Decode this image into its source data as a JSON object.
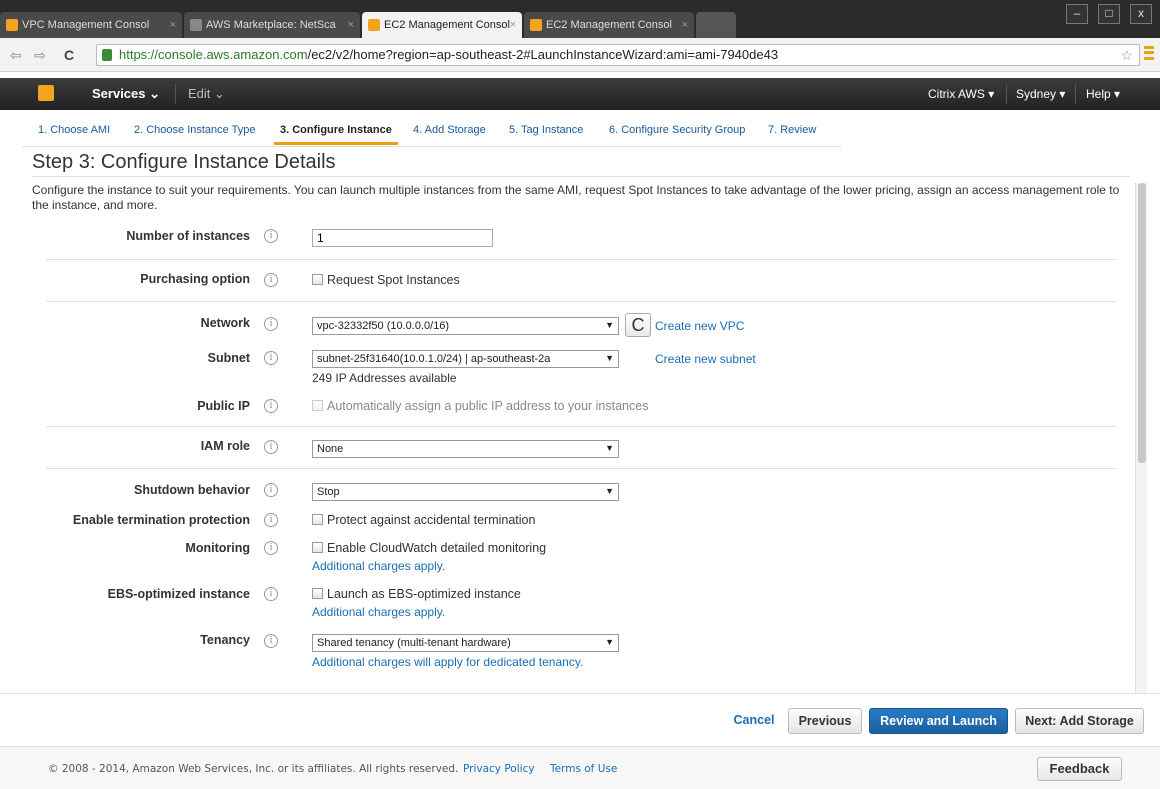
{
  "browser": {
    "tabs": [
      {
        "label": "VPC Management Consol",
        "active": false
      },
      {
        "label": "AWS Marketplace: NetSca",
        "active": false
      },
      {
        "label": "EC2 Management Consol",
        "active": true
      },
      {
        "label": "EC2 Management Consol",
        "active": false
      }
    ],
    "url_host": "https://console.aws.amazon.com",
    "url_path": "/ec2/v2/home?region=ap-southeast-2#LaunchInstanceWizard:ami=ami-7940de43"
  },
  "awsbar": {
    "services": "Services",
    "edit": "Edit",
    "account": "Citrix AWS",
    "region": "Sydney",
    "help": "Help"
  },
  "wizard": {
    "steps": [
      "1. Choose AMI",
      "2. Choose Instance Type",
      "3. Configure Instance",
      "4. Add Storage",
      "5. Tag Instance",
      "6. Configure Security Group",
      "7. Review"
    ],
    "active_step": 2,
    "title": "Step 3: Configure Instance Details",
    "description": "Configure the instance to suit your requirements. You can launch multiple instances from the same AMI, request Spot Instances to take advantage of the lower pricing, assign an access management role to the instance, and more."
  },
  "form": {
    "num_instances_label": "Number of instances",
    "num_instances_value": "1",
    "purchasing_label": "Purchasing option",
    "purchasing_cb": "Request Spot Instances",
    "network_label": "Network",
    "network_value": "vpc-32332f50 (10.0.0.0/16)",
    "network_link": "Create new VPC",
    "subnet_label": "Subnet",
    "subnet_value": "subnet-25f31640(10.0.1.0/24) | ap-southeast-2a",
    "subnet_link": "Create new subnet",
    "subnet_note": "249 IP Addresses available",
    "publicip_label": "Public IP",
    "publicip_cb": "Automatically assign a public IP address to your instances",
    "iam_label": "IAM role",
    "iam_value": "None",
    "shutdown_label": "Shutdown behavior",
    "shutdown_value": "Stop",
    "termination_label": "Enable termination protection",
    "termination_cb": "Protect against accidental termination",
    "monitoring_label": "Monitoring",
    "monitoring_cb": "Enable CloudWatch detailed monitoring",
    "monitoring_note": "Additional charges apply.",
    "ebs_label": "EBS-optimized instance",
    "ebs_cb": "Launch as EBS-optimized instance",
    "ebs_note": "Additional charges apply.",
    "tenancy_label": "Tenancy",
    "tenancy_value": "Shared tenancy (multi-tenant hardware)",
    "tenancy_note": "Additional charges will apply for dedicated tenancy."
  },
  "buttons": {
    "cancel": "Cancel",
    "previous": "Previous",
    "review": "Review and Launch",
    "next": "Next: Add Storage"
  },
  "footer": {
    "copyright": "© 2008 - 2014, Amazon Web Services, Inc. or its affiliates. All rights reserved.",
    "privacy": "Privacy Policy",
    "terms": "Terms of Use",
    "feedback": "Feedback"
  },
  "icons": {
    "info": "i",
    "refresh": "C",
    "dropdown": "▼"
  }
}
